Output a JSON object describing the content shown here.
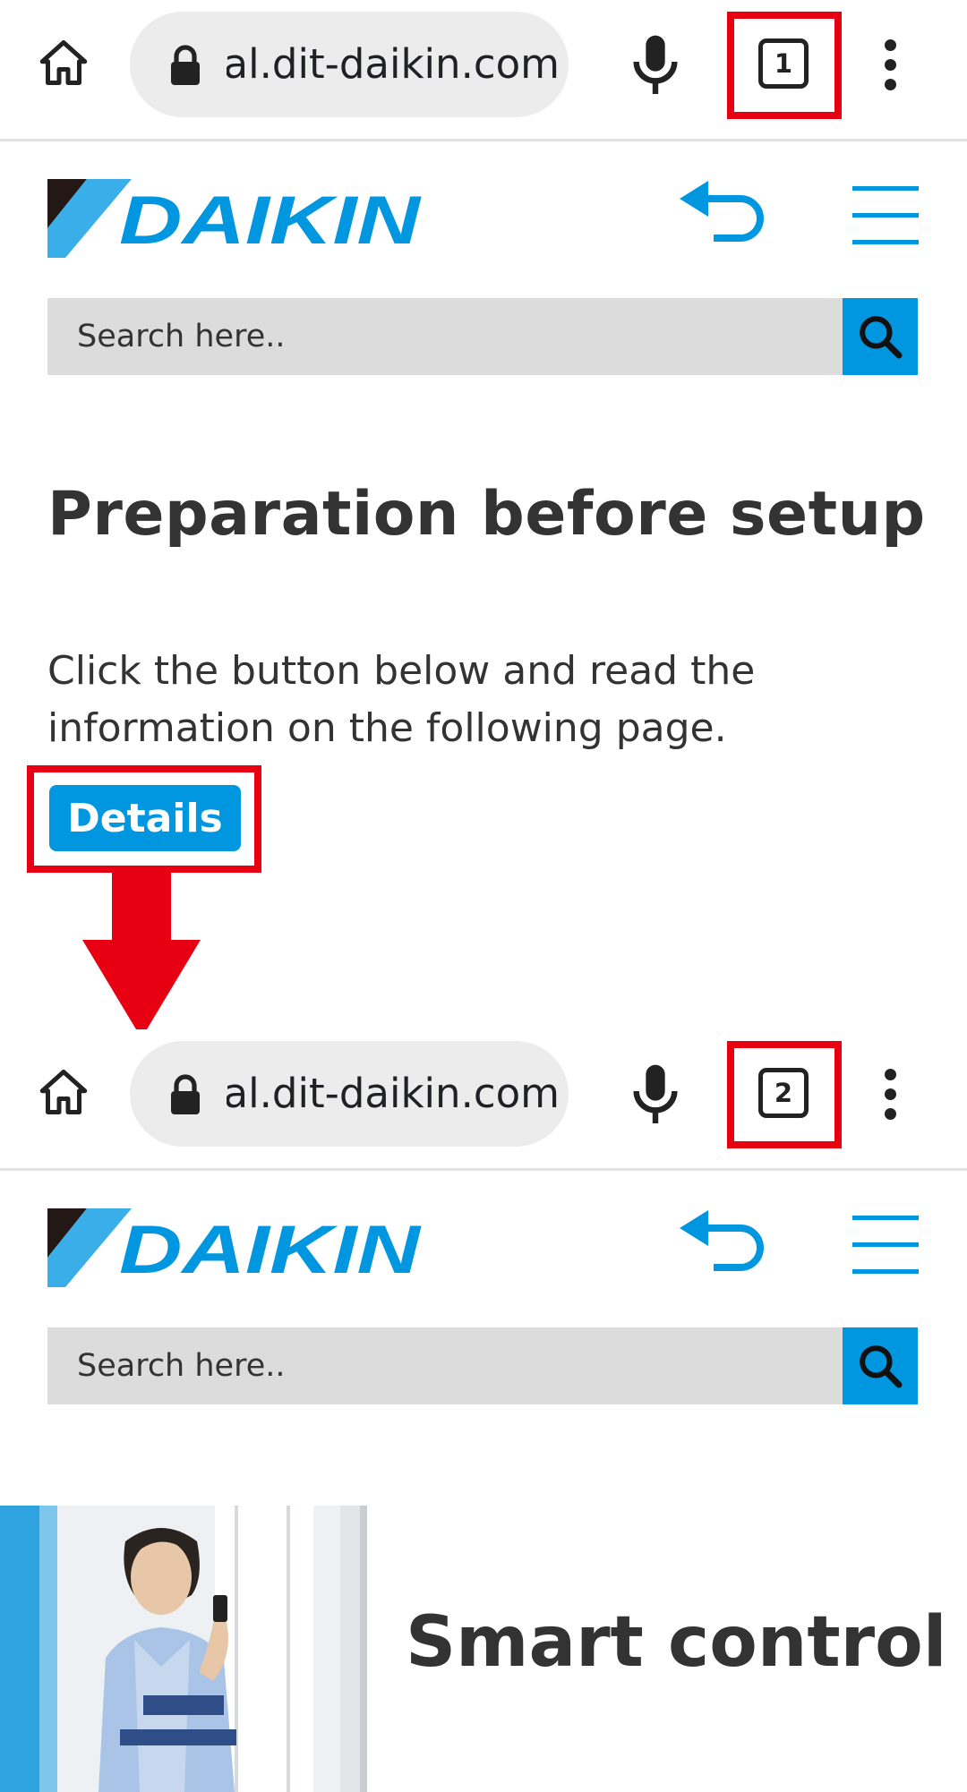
{
  "screen1": {
    "browser": {
      "url": "ial.dit-daikin.com",
      "tab_count": "1"
    },
    "site": {
      "logo_text": "DAIKIN",
      "search_placeholder": "Search here.."
    },
    "content": {
      "title": "Preparation before setup",
      "instruction": "Click the button below and read the information on the following page.",
      "details_label": "Details"
    }
  },
  "screen2": {
    "browser": {
      "url": "ial.dit-daikin.com",
      "tab_count": "2"
    },
    "site": {
      "logo_text": "DAIKIN",
      "search_placeholder": "Search here.."
    },
    "content": {
      "hero_title": "Smart control"
    }
  },
  "colors": {
    "brand_blue": "#0097e0",
    "highlight_red": "#e60012",
    "logo_light_blue": "#3aaee8",
    "logo_dark": "#231815"
  },
  "icons": [
    "home-icon",
    "lock-icon",
    "mic-icon",
    "tabs-icon",
    "more-vert-icon",
    "back-arrow-icon",
    "hamburger-menu-icon",
    "search-icon",
    "down-arrow-icon"
  ]
}
